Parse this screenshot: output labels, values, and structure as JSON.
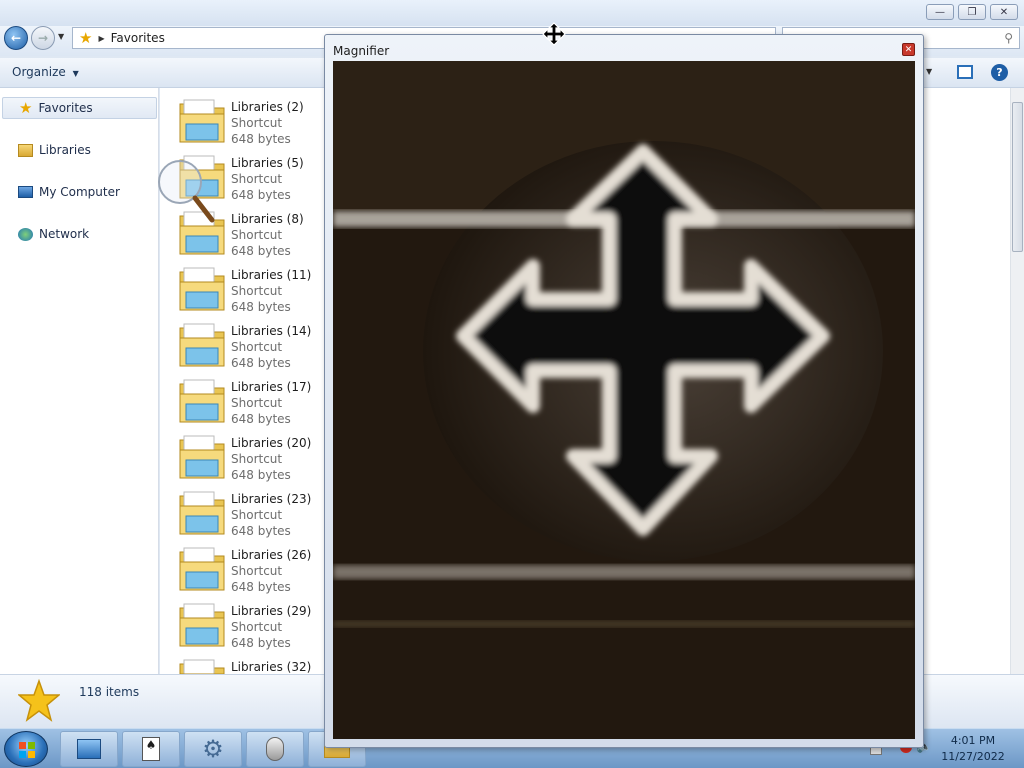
{
  "explorer": {
    "address_crumb": "Favorites",
    "organize_label": "Organize",
    "items_count": "118 items",
    "caption_buttons": {
      "minimize": "—",
      "maximize": "❐",
      "close": "✕"
    }
  },
  "nav_pane": {
    "items": [
      {
        "label": "Favorites",
        "icon": "star-icon",
        "selected": true
      },
      {
        "label": "Libraries",
        "icon": "libraries-icon",
        "selected": false
      },
      {
        "label": "My Computer",
        "icon": "computer-icon",
        "selected": false
      },
      {
        "label": "Network",
        "icon": "network-icon",
        "selected": false
      }
    ]
  },
  "files": [
    {
      "name": "Libraries (2)",
      "type": "Shortcut",
      "size": "648 bytes"
    },
    {
      "name": "Libraries (5)",
      "type": "Shortcut",
      "size": "648 bytes"
    },
    {
      "name": "Libraries (8)",
      "type": "Shortcut",
      "size": "648 bytes"
    },
    {
      "name": "Libraries (11)",
      "type": "Shortcut",
      "size": "648 bytes"
    },
    {
      "name": "Libraries (14)",
      "type": "Shortcut",
      "size": "648 bytes"
    },
    {
      "name": "Libraries (17)",
      "type": "Shortcut",
      "size": "648 bytes"
    },
    {
      "name": "Libraries (20)",
      "type": "Shortcut",
      "size": "648 bytes"
    },
    {
      "name": "Libraries (23)",
      "type": "Shortcut",
      "size": "648 bytes"
    },
    {
      "name": "Libraries (26)",
      "type": "Shortcut",
      "size": "648 bytes"
    },
    {
      "name": "Libraries (29)",
      "type": "Shortcut",
      "size": "648 bytes"
    },
    {
      "name": "Libraries (32)",
      "type": "",
      "size": ""
    }
  ],
  "magnifier": {
    "title": "Magnifier",
    "close_label": "✕"
  },
  "taskbar": {
    "time": "4:01 PM",
    "date": "11/27/2022",
    "buttons": [
      "explorer-icon",
      "solitaire-icon",
      "settings-gear-icon",
      "mouse-icon",
      "folder-icon"
    ]
  },
  "colors": {
    "accent": "#2a6fb8",
    "magnifier_bg": "#1e160e"
  }
}
